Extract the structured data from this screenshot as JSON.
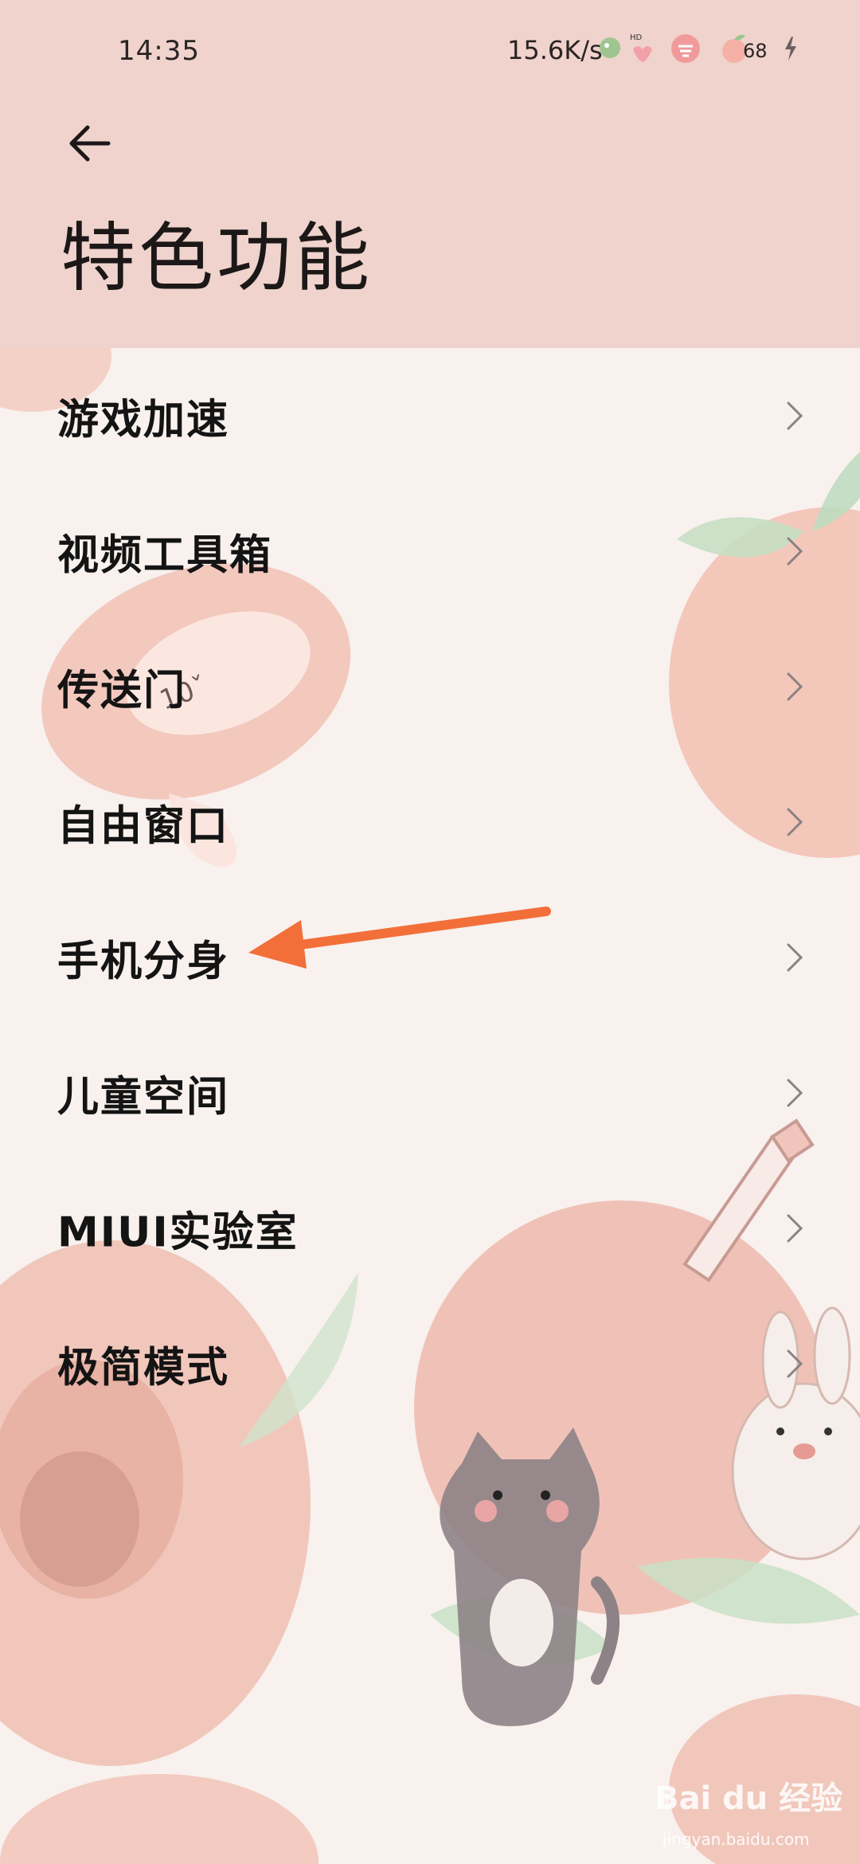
{
  "status_bar": {
    "time": "14:35",
    "network_speed": "15.6K/s",
    "battery": "68"
  },
  "header": {
    "title": "特色功能"
  },
  "menu": {
    "items": [
      {
        "label": "游戏加速"
      },
      {
        "label": "视频工具箱"
      },
      {
        "label": "传送门"
      },
      {
        "label": "自由窗口"
      },
      {
        "label": "手机分身"
      },
      {
        "label": "儿童空间"
      },
      {
        "label": "MIUI实验室"
      },
      {
        "label": "极简模式"
      }
    ]
  },
  "watermark": {
    "logo": "Bai du 经验",
    "url": "jingyan.baidu.com"
  },
  "colors": {
    "header_bg": "#efd3cc",
    "body_bg": "#f8f1ee",
    "arrow": "#f26f3a"
  }
}
